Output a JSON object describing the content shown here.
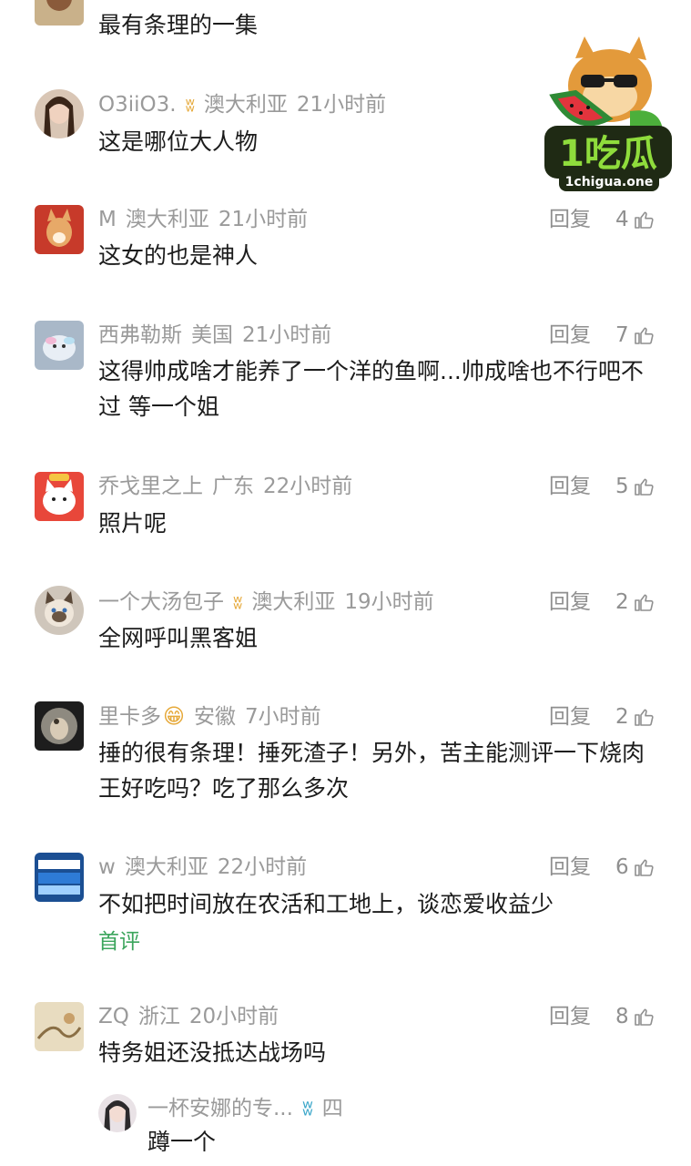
{
  "top_comment": {
    "text": "最有条理的一集"
  },
  "watermark": {
    "logo_text": "1吃瓜",
    "site": "1chigua.one"
  },
  "comments": [
    {
      "user": "O3iiO3.",
      "badge": "ʬ",
      "location": "澳大利亚",
      "time": "21小时前",
      "text": "这是哪位大人物",
      "reply": "",
      "likes": ""
    },
    {
      "user": "M",
      "location": "澳大利亚",
      "time": "21小时前",
      "text": "这女的也是神人",
      "reply": "回复",
      "likes": "4"
    },
    {
      "user": "西弗勒斯",
      "location": "美国",
      "time": "21小时前",
      "text": "这得帅成啥才能养了一个洋的鱼啊...帅成啥也不行吧不过 等一个姐",
      "reply": "回复",
      "likes": "7"
    },
    {
      "user": "乔戈里之上",
      "location": "广东",
      "time": "22小时前",
      "text": "照片呢",
      "reply": "回复",
      "likes": "5"
    },
    {
      "user": "一个大汤包子",
      "badge": "ʬ",
      "location": "澳大利亚",
      "time": "19小时前",
      "text": "全网呼叫黑客姐",
      "reply": "回复",
      "likes": "2"
    },
    {
      "user": "里卡多",
      "emoji": "😁",
      "location": "安徽",
      "time": "7小时前",
      "text": "捶的很有条理！捶死渣子！另外，苦主能测评一下烧肉王好吃吗？吃了那么多次",
      "reply": "回复",
      "likes": "2"
    },
    {
      "user": "w",
      "location": "澳大利亚",
      "time": "22小时前",
      "text": "不如把时间放在农活和工地上，谈恋爱收益少",
      "tag": "首评",
      "reply": "回复",
      "likes": "6"
    },
    {
      "user": "ZQ",
      "location": "浙江",
      "time": "20小时前",
      "text": "特务姐还没抵达战场吗",
      "reply": "回复",
      "likes": "8"
    }
  ],
  "sub_reply": {
    "user": "一杯安娜的专...",
    "badge": "ʬ",
    "location": "四",
    "text": "蹲一个"
  },
  "colors": {
    "meta": "#9a9a9a",
    "text": "#1c1c1c",
    "first_tag": "#3ba55c"
  },
  "icons": {
    "like": "thumbs-up-icon"
  }
}
